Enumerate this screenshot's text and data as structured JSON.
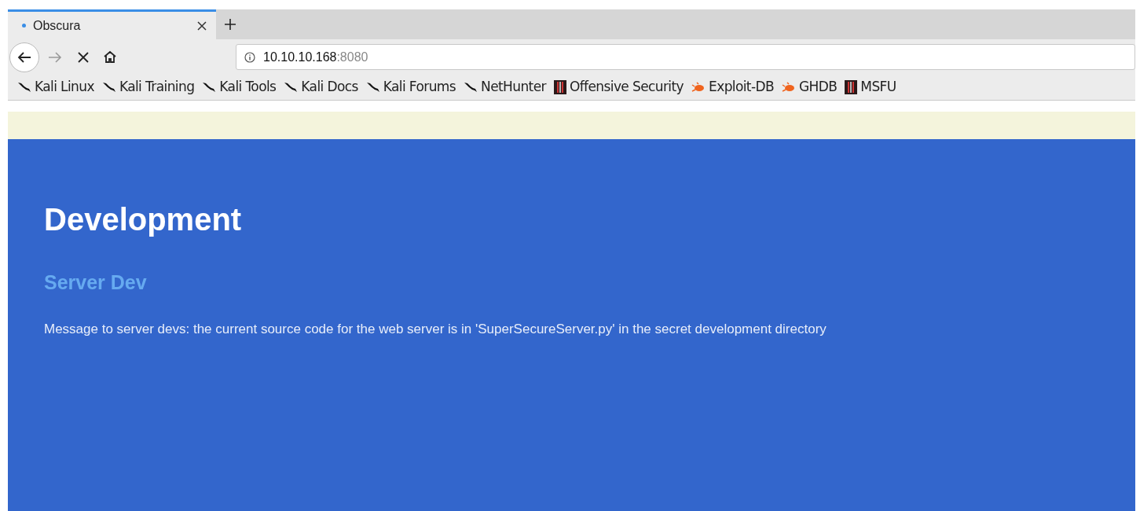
{
  "tabs": [
    {
      "title": "Obscura",
      "selected": true
    }
  ],
  "address_bar": {
    "host": "10.10.10.168",
    "port": ":8080"
  },
  "bookmarks": [
    {
      "label": "Kali Linux",
      "kind": "kali"
    },
    {
      "label": "Kali Training",
      "kind": "kali"
    },
    {
      "label": "Kali Tools",
      "kind": "kali"
    },
    {
      "label": "Kali Docs",
      "kind": "kali"
    },
    {
      "label": "Kali Forums",
      "kind": "kali"
    },
    {
      "label": "NetHunter",
      "kind": "kali"
    },
    {
      "label": "Offensive Security",
      "kind": "offsec"
    },
    {
      "label": "Exploit-DB",
      "kind": "exploit"
    },
    {
      "label": "GHDB",
      "kind": "exploit"
    },
    {
      "label": "MSFU",
      "kind": "offsec"
    }
  ],
  "page": {
    "heading": "Development",
    "subheading": "Server Dev",
    "message": "Message to server devs: the current source code for the web server is in 'SuperSecureServer.py' in the secret development directory"
  }
}
